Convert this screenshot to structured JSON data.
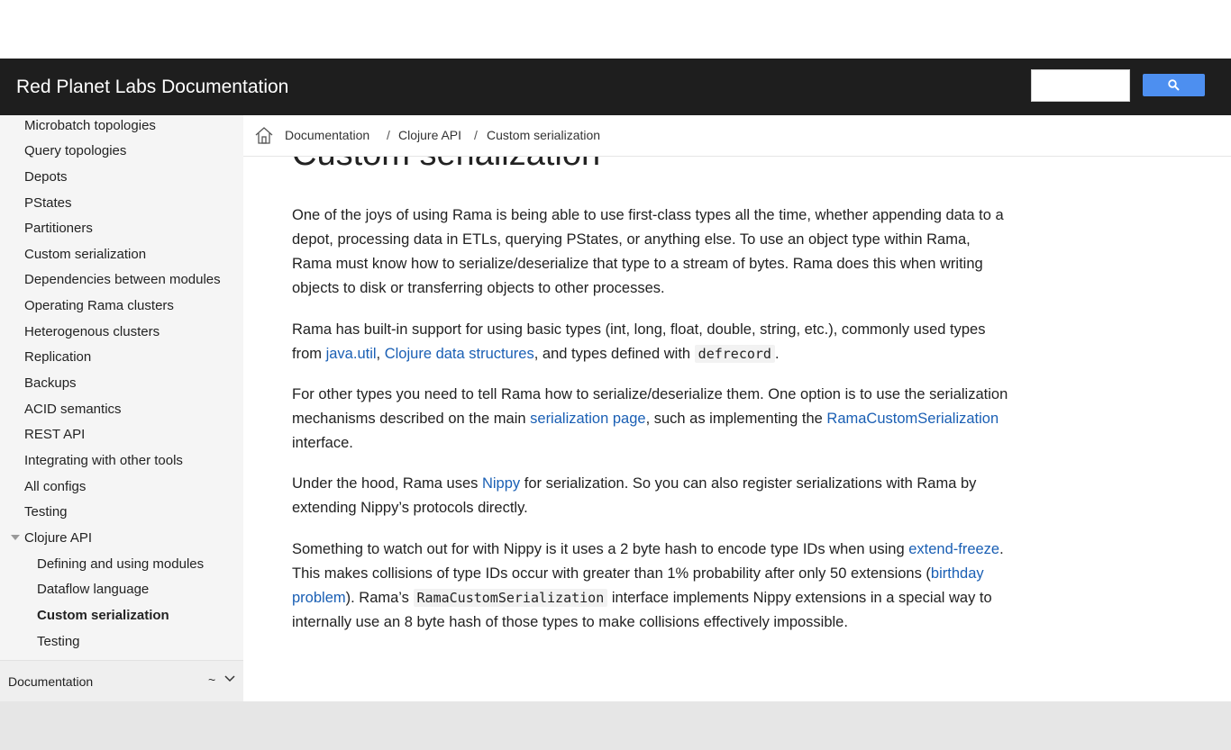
{
  "header": {
    "title": "Red Planet Labs Documentation",
    "search_placeholder": "",
    "search_icon": "search-icon",
    "background": "#1e1e1e",
    "search_button_color": "#4d8ff0"
  },
  "sidebar": {
    "items": [
      {
        "label": "Microbatch topologies"
      },
      {
        "label": "Query topologies"
      },
      {
        "label": "Depots"
      },
      {
        "label": "PStates"
      },
      {
        "label": "Partitioners"
      },
      {
        "label": "Custom serialization"
      },
      {
        "label": "Dependencies between modules"
      },
      {
        "label": "Operating Rama clusters"
      },
      {
        "label": "Heterogenous clusters"
      },
      {
        "label": "Replication"
      },
      {
        "label": "Backups"
      },
      {
        "label": "ACID semantics"
      },
      {
        "label": "REST API"
      },
      {
        "label": "Integrating with other tools"
      },
      {
        "label": "All configs"
      },
      {
        "label": "Testing"
      },
      {
        "label": "Clojure API"
      }
    ],
    "subitems": [
      {
        "label": "Defining and using modules"
      },
      {
        "label": "Dataflow language"
      },
      {
        "label": "Custom serialization"
      },
      {
        "label": "Testing"
      }
    ],
    "footer": {
      "label": "Documentation",
      "version": "~"
    }
  },
  "breadcrumb": {
    "items": [
      "Documentation",
      "Clojure API",
      "Custom serialization"
    ],
    "separator": "/"
  },
  "main": {
    "title": "Custom serialization",
    "p1": "One of the joys of using Rama is being able to use first-class types all the time, whether appending data to a depot, processing data in ETLs, querying PStates, or anything else. To use an object type within Rama, Rama must know how to serialize/deserialize that type to a stream of bytes. Rama does this when writing objects to disk or transferring objects to other processes.",
    "p2": {
      "a": "Rama has built-in support for using basic types (int, long, float, double, string, etc.), commonly used types from ",
      "link1": "java.util",
      "b": ", ",
      "link2": "Clojure data structures",
      "c": ", and types defined with ",
      "code": "defrecord",
      "d": "."
    },
    "p3": {
      "a": "For other types you need to tell Rama how to serialize/deserialize them. One option is to use the serialization mechanisms described on the main ",
      "link1": "serialization page",
      "b": ", such as implementing the ",
      "link2": "RamaCustomSerialization",
      "c": " interface."
    },
    "p4": {
      "a": "Under the hood, Rama uses ",
      "link1": "Nippy",
      "b": " for serialization. So you can also register serializations with Rama by extending Nippy’s protocols directly."
    },
    "p5": {
      "a": "Something to watch out for with Nippy is it uses a 2 byte hash to encode type IDs when using ",
      "link1": "extend-freeze",
      "b": ". This makes collisions of type IDs occur with greater than 1% probability after only 50 extensions (",
      "link2": "birthday problem",
      "c": "). Rama’s ",
      "code": "RamaCustomSerialization",
      "d": " interface implements Nippy extensions in a special way to internally use an 8 byte hash of those types to make collisions effectively impossible."
    }
  }
}
